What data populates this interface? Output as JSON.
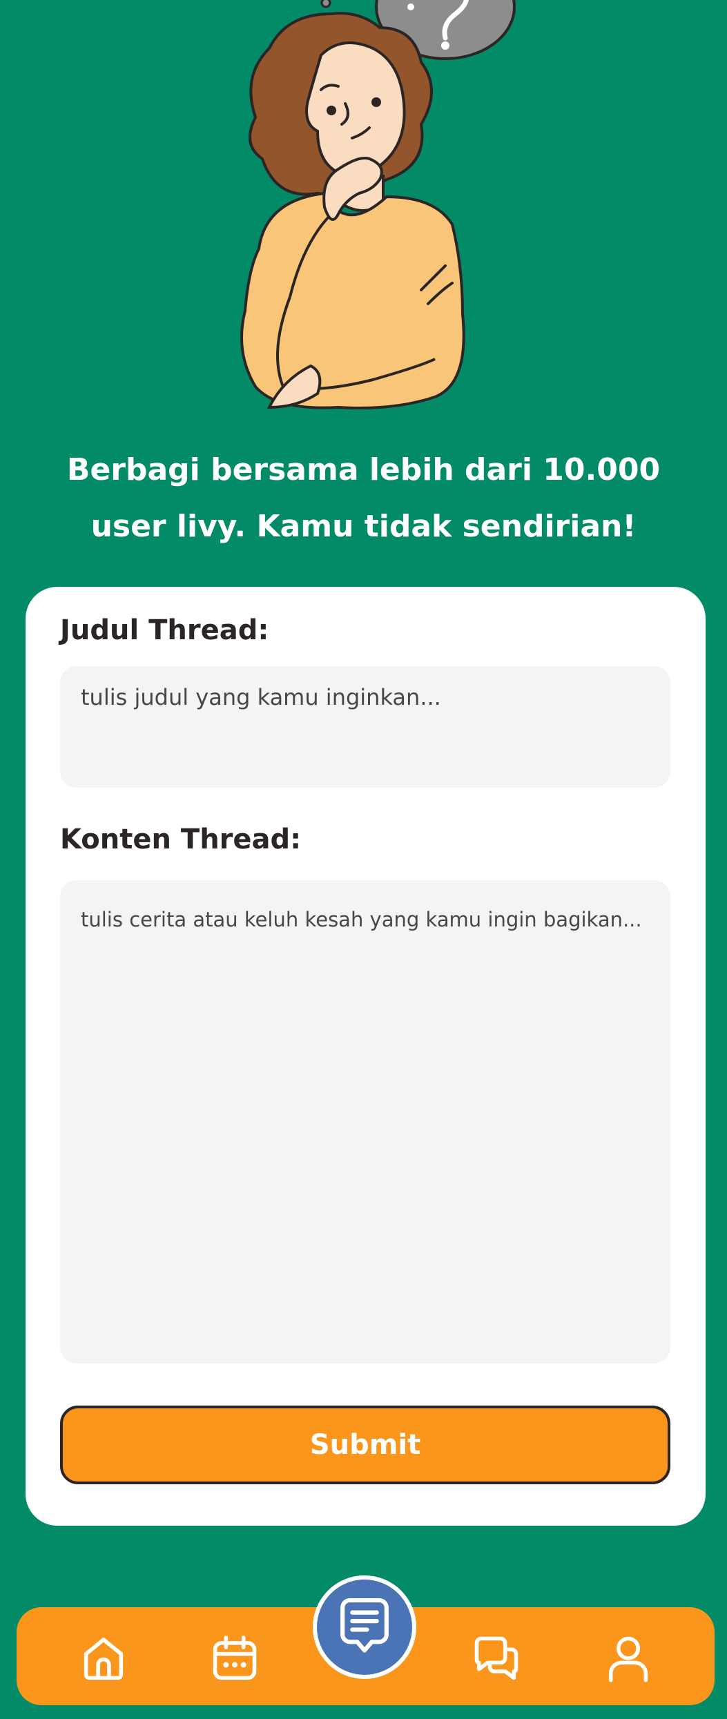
{
  "headline": {
    "line1": "Berbagi bersama lebih dari 10.000",
    "line2": "user livy. Kamu tidak sendirian!"
  },
  "form": {
    "title_label": "Judul Thread:",
    "title_placeholder": "tulis judul yang kamu inginkan...",
    "content_label": "Konten Thread:",
    "content_placeholder": "tulis cerita atau keluh kesah yang kamu ingin bagikan...",
    "submit_label": "Submit"
  },
  "bottom_nav": {
    "items": [
      {
        "icon": "home-icon"
      },
      {
        "icon": "calendar-icon"
      },
      {
        "icon": "new-thread-icon",
        "active": true
      },
      {
        "icon": "chat-icon"
      },
      {
        "icon": "profile-icon"
      }
    ]
  },
  "colors": {
    "background": "#038a67",
    "accent": "#fa961b",
    "fab": "#4a74b6",
    "card": "#ffffff",
    "field": "#f4f4f4",
    "text_dark": "#2b2525"
  }
}
